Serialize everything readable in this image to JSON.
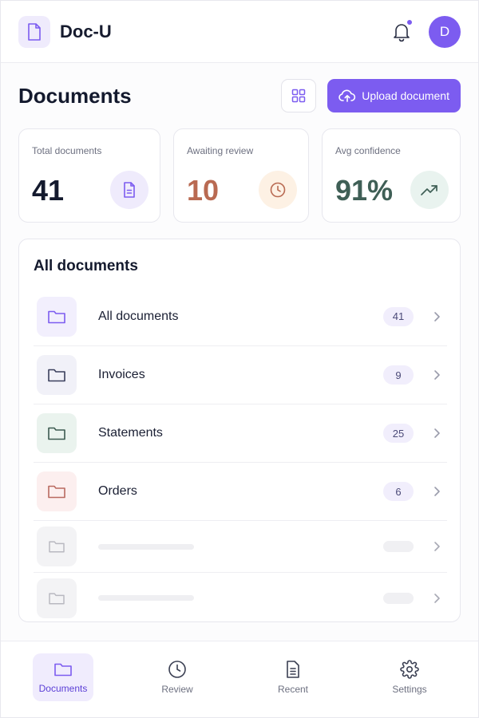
{
  "header": {
    "app_name": "Doc-U",
    "logo_icon": "document-icon",
    "notification_icon": "bell-icon",
    "avatar_initial": "D"
  },
  "page": {
    "title": "Documents",
    "grid_view_icon": "grid-icon",
    "upload_label": "Upload document",
    "upload_icon": "cloud-upload-icon"
  },
  "stats": [
    {
      "label": "Total documents",
      "value": "41",
      "icon": "document-icon",
      "value_color": "#141a2e",
      "icon_bg": "#efebfc",
      "icon_color": "#7c5cf0"
    },
    {
      "label": "Awaiting review",
      "value": "10",
      "icon": "clock-icon",
      "value_color": "#b96a52",
      "icon_bg": "#fdf1e4",
      "icon_color": "#b96a52"
    },
    {
      "label": "Avg confidence",
      "value": "91%",
      "icon": "trending-up-icon",
      "value_color": "#3f5f56",
      "icon_bg": "#e9f3ef",
      "icon_color": "#3f5f56"
    }
  ],
  "documents": {
    "title": "All documents",
    "items": [
      {
        "name": "All documents",
        "count": "41",
        "icon": "folder-icon",
        "folder_bg": "#f2effd",
        "folder_color": "#7c5cf0"
      },
      {
        "name": "Invoices",
        "count": "9",
        "icon": "folder-icon",
        "folder_bg": "#f1f1f8",
        "folder_color": "#3a3f5c"
      },
      {
        "name": "Statements",
        "count": "25",
        "icon": "folder-icon",
        "folder_bg": "#eaf3ee",
        "folder_color": "#3c5a50"
      },
      {
        "name": "Orders",
        "count": "6",
        "icon": "folder-icon",
        "folder_bg": "#fcefef",
        "folder_color": "#b96a60"
      }
    ],
    "placeholder_rows": 2
  },
  "nav": [
    {
      "label": "Documents",
      "icon": "folder-icon",
      "active": true
    },
    {
      "label": "Review",
      "icon": "clock-icon",
      "active": false
    },
    {
      "label": "Recent",
      "icon": "file-list-icon",
      "active": false
    },
    {
      "label": "Settings",
      "icon": "gear-icon",
      "active": false
    }
  ],
  "colors": {
    "accent": "#7c5cf0",
    "placeholder": "#b8b8c0"
  }
}
